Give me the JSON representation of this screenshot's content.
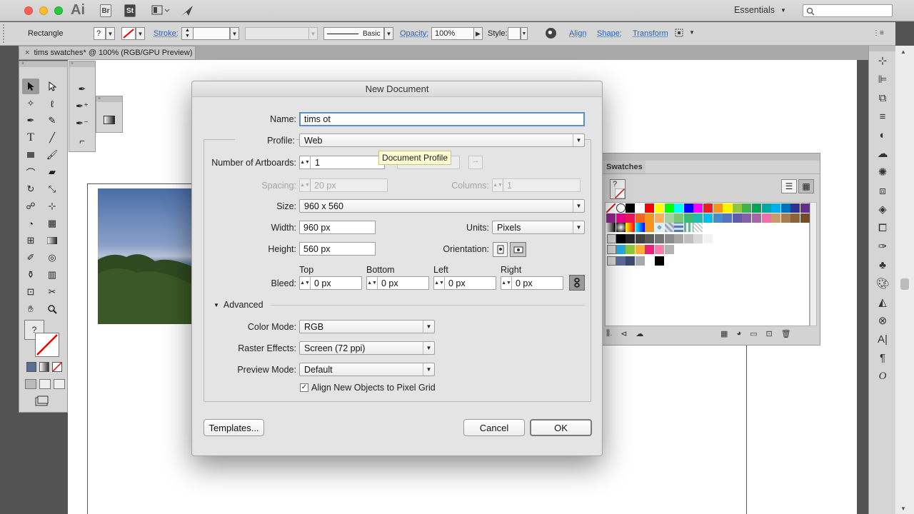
{
  "app": {
    "logo": "Ai",
    "bridge": "Br",
    "stock": "St",
    "workspace": "Essentials",
    "search_icon": "search-icon"
  },
  "control_bar": {
    "object": "Rectangle",
    "fill": "?",
    "stroke_label": "Stroke:",
    "stroke_value": "",
    "brush_value": "Basic",
    "opacity_label": "Opacity:",
    "opacity_value": "100%",
    "style_label": "Style:",
    "align_label": "Align",
    "shape_label": "Shape:",
    "transform_label": "Transform"
  },
  "document_tab": {
    "title": "tims swatches* @ 100% (RGB/GPU Preview)",
    "close": "×"
  },
  "dialog": {
    "title": "New Document",
    "name_label": "Name:",
    "name_value": "tims ot",
    "profile_label": "Profile:",
    "profile_value": "Web",
    "artboards_label": "Number of Artboards:",
    "artboards_value": "1",
    "tooltip": "Document Profile",
    "spacing_label": "Spacing:",
    "spacing_value": "20 px",
    "columns_label": "Columns:",
    "columns_value": "1",
    "size_label": "Size:",
    "size_value": "960 x 560",
    "width_label": "Width:",
    "width_value": "960 px",
    "units_label": "Units:",
    "units_value": "Pixels",
    "height_label": "Height:",
    "height_value": "560 px",
    "orientation_label": "Orientation:",
    "bleed_label": "Bleed:",
    "bleed_top_label": "Top",
    "bleed_bottom_label": "Bottom",
    "bleed_left_label": "Left",
    "bleed_right_label": "Right",
    "bleed_top": "0 px",
    "bleed_bottom": "0 px",
    "bleed_left": "0 px",
    "bleed_right": "0 px",
    "advanced_label": "Advanced",
    "color_mode_label": "Color Mode:",
    "color_mode_value": "RGB",
    "raster_label": "Raster Effects:",
    "raster_value": "Screen (72 ppi)",
    "preview_label": "Preview Mode:",
    "preview_value": "Default",
    "align_pixel_label": "Align New Objects to Pixel Grid",
    "align_pixel_checked": true,
    "templates_button": "Templates...",
    "cancel_button": "Cancel",
    "ok_button": "OK"
  },
  "swatches_panel": {
    "title": "Swatches",
    "none_swatch": "?",
    "row1": [
      "#000000",
      "#ffffff",
      "#ff0000",
      "#ffff00",
      "#00ff00",
      "#00ffff",
      "#0000ff",
      "#ff00ff",
      "#ed1c24",
      "#f7941d",
      "#fff200",
      "#8dc63f",
      "#39b54a",
      "#00a651",
      "#00a99d",
      "#00aeef",
      "#0072bc",
      "#2e3192",
      "#662d91",
      "#92278f",
      "#ec008c",
      "#ed145b",
      "#f26522",
      "#f7941d",
      "#fbaf5d",
      "#a3d39c",
      "#7cc576",
      "#3cb878"
    ],
    "row2": [
      "#1cbbb4",
      "#00bff3",
      "#448ccb",
      "#5674b9",
      "#605ca8",
      "#855fa8",
      "#a864a8",
      "#f06eaa",
      "#c69c6d",
      "#a67c52",
      "#8c6239",
      "#754c24",
      "#603913",
      "#998675",
      "#736357",
      "#534741",
      "#362f2d",
      "#c7b299",
      "#998675"
    ],
    "row3_labels": [
      "gradient",
      "pattern"
    ],
    "grays": [
      "#000000",
      "#262626",
      "#404040",
      "#595959",
      "#737373",
      "#8c8c8c",
      "#a6a6a6",
      "#bfbfbf",
      "#d9d9d9",
      "#f2f2f2"
    ],
    "group2": [
      "#29abe2",
      "#8cc63f",
      "#fbb03b",
      "#ed1e79",
      "#ff7bac",
      "#b3b3b3"
    ],
    "group3": [
      "#5e6b9c",
      "#3d4b6e",
      "#a7a9ac",
      "#ffffff",
      "#000000"
    ]
  },
  "colors": {
    "accent": "#2a63b9",
    "tooltip_bg": "#fdfbcf"
  }
}
